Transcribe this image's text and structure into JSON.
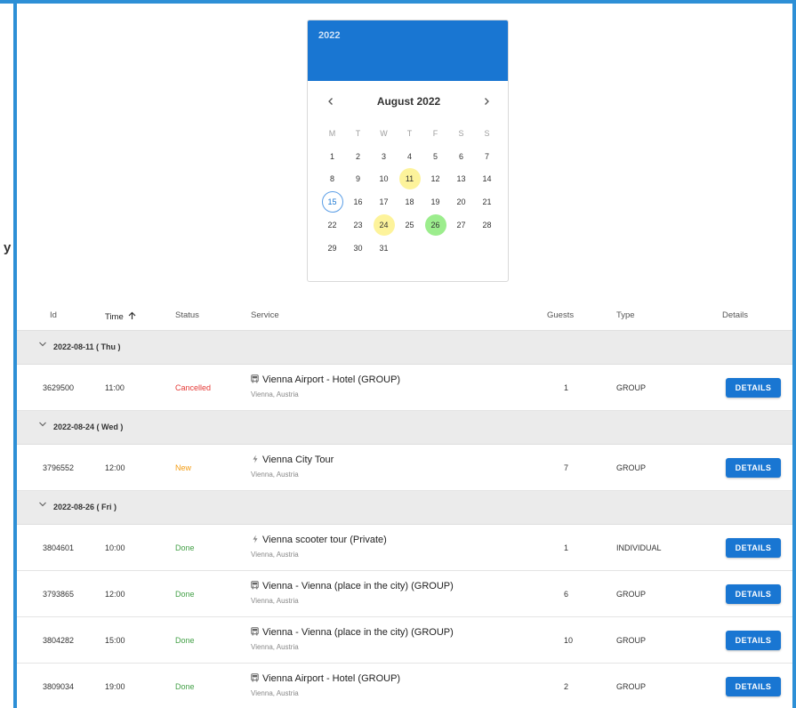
{
  "cut_glyph": "y",
  "calendar": {
    "year": "2022",
    "month_label": "August 2022",
    "prev_icon": "chevron-left-icon",
    "next_icon": "chevron-right-icon",
    "weekdays": [
      "M",
      "T",
      "W",
      "T",
      "F",
      "S",
      "S"
    ],
    "days": [
      "1",
      "2",
      "3",
      "4",
      "5",
      "6",
      "7",
      "8",
      "9",
      "10",
      "11",
      "12",
      "13",
      "14",
      "15",
      "16",
      "17",
      "18",
      "19",
      "20",
      "21",
      "22",
      "23",
      "24",
      "25",
      "26",
      "27",
      "28",
      "29",
      "30",
      "31"
    ],
    "today": "15",
    "highlight_yellow": [
      "11",
      "24"
    ],
    "highlight_green": [
      "26"
    ],
    "colors": {
      "header": "#1976d2",
      "yellow": "#fdf39b",
      "green": "#9ced8d"
    }
  },
  "table": {
    "headers": {
      "id": "Id",
      "time": "Time",
      "status": "Status",
      "service": "Service",
      "guests": "Guests",
      "type": "Type",
      "details": "Details"
    },
    "sort_icon": "arrow-up-icon",
    "details_label": "DETAILS",
    "groups": [
      {
        "label": "2022-08-11 ( Thu )",
        "rows": [
          {
            "id": "3629500",
            "time": "11:00",
            "status": "Cancelled",
            "service_icon": "bus-icon",
            "service": "Vienna Airport - Hotel (GROUP)",
            "location": "Vienna, Austria",
            "guests": "1",
            "type": "GROUP"
          }
        ]
      },
      {
        "label": "2022-08-24 ( Wed )",
        "rows": [
          {
            "id": "3796552",
            "time": "12:00",
            "status": "New",
            "service_icon": "bolt-icon",
            "service": "Vienna City Tour",
            "location": "Vienna, Austria",
            "guests": "7",
            "type": "GROUP"
          }
        ]
      },
      {
        "label": "2022-08-26 ( Fri )",
        "rows": [
          {
            "id": "3804601",
            "time": "10:00",
            "status": "Done",
            "service_icon": "bolt-icon",
            "service": "Vienna scooter tour (Private)",
            "location": "Vienna, Austria",
            "guests": "1",
            "type": "INDIVIDUAL"
          },
          {
            "id": "3793865",
            "time": "12:00",
            "status": "Done",
            "service_icon": "bus-icon",
            "service": "Vienna - Vienna (place in the city) (GROUP)",
            "location": "Vienna, Austria",
            "guests": "6",
            "type": "GROUP"
          },
          {
            "id": "3804282",
            "time": "15:00",
            "status": "Done",
            "service_icon": "bus-icon",
            "service": "Vienna - Vienna (place in the city) (GROUP)",
            "location": "Vienna, Austria",
            "guests": "10",
            "type": "GROUP"
          },
          {
            "id": "3809034",
            "time": "19:00",
            "status": "Done",
            "service_icon": "bus-icon",
            "service": "Vienna Airport - Hotel (GROUP)",
            "location": "Vienna, Austria",
            "guests": "2",
            "type": "GROUP"
          }
        ]
      }
    ]
  }
}
